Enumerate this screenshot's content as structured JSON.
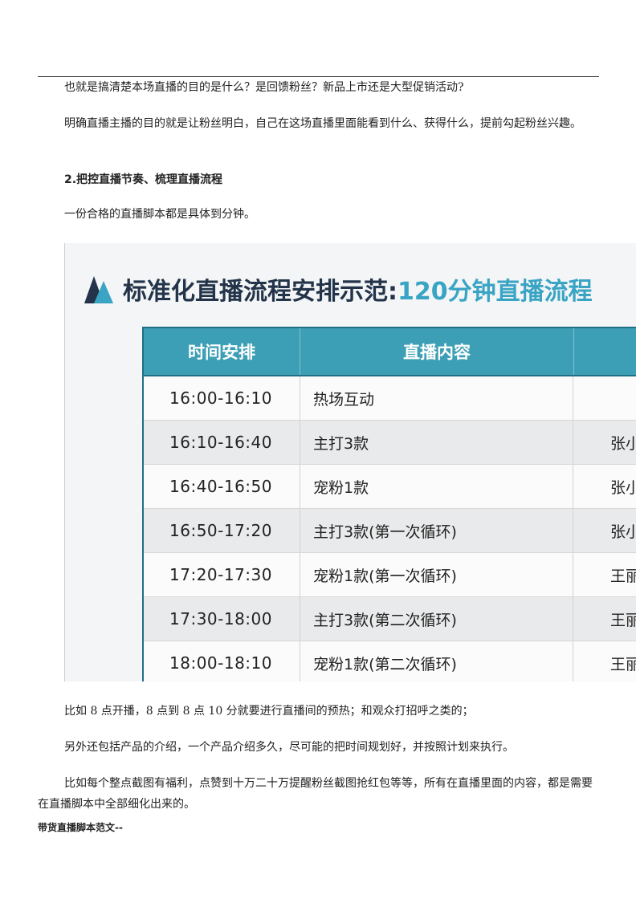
{
  "paragraphs": {
    "p1": "也就是搞清楚本场直播的目的是什么？是回馈粉丝？新品上市还是大型促销活动?",
    "p2": "明确直播主播的目的就是让粉丝明白，自己在这场直播里面能看到什么、获得什么，提前勾起粉丝兴趣。",
    "heading": "2.把控直播节奏、梳理直播流程",
    "p3": "一份合格的直播脚本都是具体到分钟。",
    "p4": "比如 8 点开播，8 点到 8 点 10 分就要进行直播间的预热；和观众打招呼之类的；",
    "p5": "另外还包括产品的介绍，一个产品介绍多久，尽可能的把时间规划好，并按照计划来执行。",
    "p6": "比如每个整点截图有福利，点赞到十万二十万提醒粉丝截图抢红包等等，所有在直播里面的内容，都是需要在直播脚本中全部细化出来的。",
    "footer": "带货直播脚本范文--"
  },
  "figure": {
    "title": "标准化直播流程安排示范:",
    "title_accent": "120分钟直播流程",
    "table": {
      "headers": [
        "时间安排",
        "直播内容",
        ""
      ],
      "rows": [
        [
          "16:00-16:10",
          "热场互动",
          ""
        ],
        [
          "16:10-16:40",
          "主打3款",
          "张小"
        ],
        [
          "16:40-16:50",
          "宠粉1款",
          "张小"
        ],
        [
          "16:50-17:20",
          "主打3款(第一次循环)",
          "张小"
        ],
        [
          "17:20-17:30",
          "宠粉1款(第一次循环)",
          "王丽"
        ],
        [
          "17:30-18:00",
          "主打3款(第二次循环)",
          "王丽"
        ],
        [
          "18:00-18:10",
          "宠粉1款(第二次循环)",
          "王丽"
        ]
      ]
    }
  }
}
